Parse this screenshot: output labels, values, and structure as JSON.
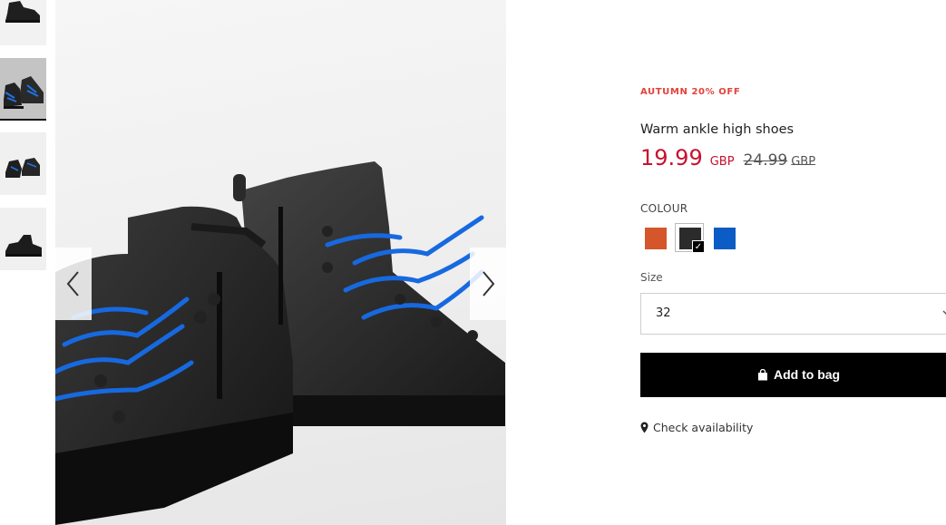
{
  "gallery": {
    "thumbnails": [
      {
        "icon": "boot-thumbnail-side"
      },
      {
        "icon": "boot-thumbnail-pair-active"
      },
      {
        "icon": "boot-thumbnail-pair"
      },
      {
        "icon": "boot-thumbnail-single"
      }
    ],
    "active_index": 1,
    "prev_icon": "chevron-left-icon",
    "next_icon": "chevron-right-icon"
  },
  "product": {
    "promo": "AUTUMN 20% OFF",
    "title": "Warm ankle high shoes",
    "price": {
      "current": "19.99",
      "current_currency": "GBP",
      "old": "24.99",
      "old_currency": "GBP"
    },
    "colour": {
      "label": "COLOUR",
      "swatches": [
        {
          "name": "orange",
          "hex": "#d5562a",
          "selected": false
        },
        {
          "name": "black",
          "hex": "#2b2b2b",
          "selected": true
        },
        {
          "name": "blue",
          "hex": "#0b5cc4",
          "selected": false
        }
      ],
      "selected_icon": "checkmark-icon"
    },
    "size": {
      "label": "Size",
      "selected": "32",
      "icon": "chevron-down-icon"
    },
    "add_to_bag": {
      "label": "Add to bag",
      "icon": "shopping-bag-icon"
    },
    "availability": {
      "label": "Check availability",
      "icon": "map-pin-icon"
    }
  },
  "colors": {
    "promo": "#e2423a",
    "price": "#c8102e",
    "button_bg": "#000000"
  }
}
